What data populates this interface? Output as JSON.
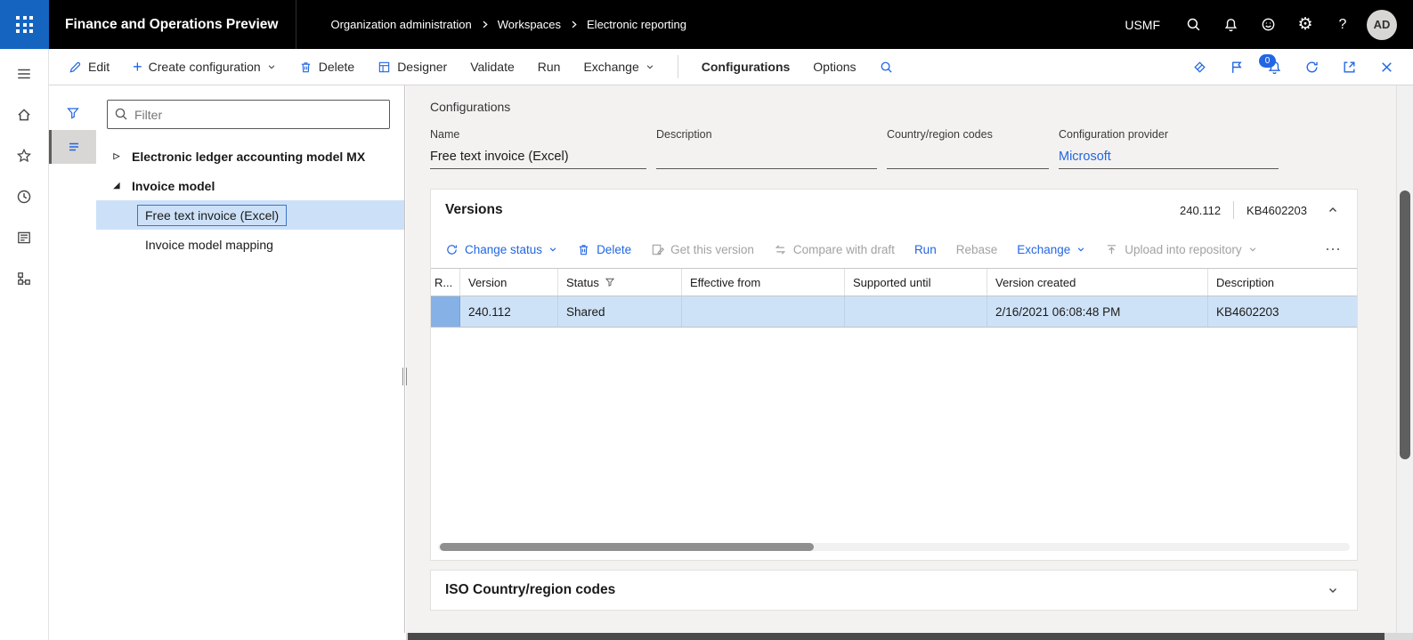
{
  "icons": {
    "gear": "⚙",
    "help": "?",
    "more": "⋯",
    "plus": "+",
    "tree_collapsed": "▷",
    "tree_expanded": "◢"
  },
  "top_bar": {
    "app_title": "Finance and Operations Preview",
    "breadcrumb": [
      "Organization administration",
      "Workspaces",
      "Electronic reporting"
    ],
    "company": "USMF",
    "avatar_initials": "AD"
  },
  "action_bar": {
    "edit_label": "Edit",
    "create_configuration_label": "Create configuration",
    "delete_label": "Delete",
    "designer_label": "Designer",
    "validate_label": "Validate",
    "run_label": "Run",
    "exchange_label": "Exchange",
    "tab_configurations": "Configurations",
    "tab_options": "Options",
    "notification_count": "0"
  },
  "tree_panel": {
    "filter_placeholder": "Filter",
    "items": [
      {
        "label": "Electronic ledger accounting model MX"
      },
      {
        "label": "Invoice model"
      },
      {
        "label": "Free text invoice (Excel)"
      },
      {
        "label": "Invoice model mapping"
      }
    ]
  },
  "main": {
    "page_title": "Configurations",
    "fields": {
      "name_label": "Name",
      "name_value": "Free text invoice (Excel)",
      "description_label": "Description",
      "description_value": "",
      "country_label": "Country/region codes",
      "country_value": "",
      "provider_label": "Configuration provider",
      "provider_value": "Microsoft"
    },
    "versions": {
      "title": "Versions",
      "version_number": "240.112",
      "kb_number": "KB4602203",
      "toolbar": {
        "change_status": "Change status",
        "delete": "Delete",
        "get_this_version": "Get this version",
        "compare_with_draft": "Compare with draft",
        "run": "Run",
        "rebase": "Rebase",
        "exchange": "Exchange",
        "upload_into_repository": "Upload into repository"
      },
      "grid": {
        "columns": [
          "R...",
          "Version",
          "Status",
          "Effective from",
          "Supported until",
          "Version created",
          "Description"
        ],
        "rows": [
          [
            "240.112",
            "Shared",
            "",
            "",
            "2/16/2021 06:08:48 PM",
            "KB4602203"
          ]
        ]
      }
    },
    "iso_section": {
      "title": "ISO Country/region codes"
    }
  }
}
